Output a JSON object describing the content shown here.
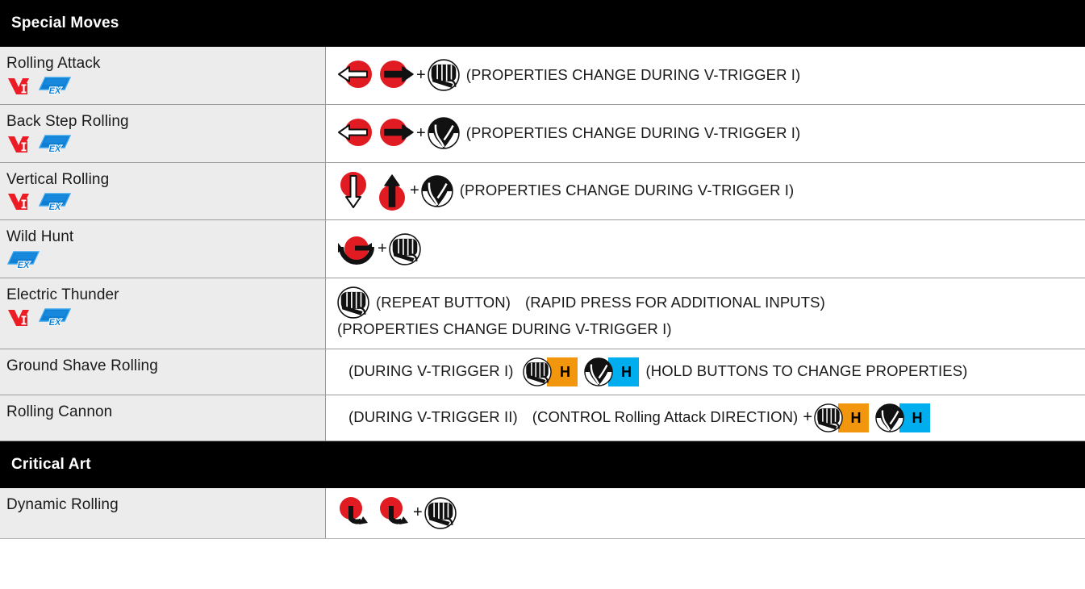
{
  "sections": [
    {
      "id": "special-moves",
      "title": "Special Moves",
      "moves": [
        {
          "name": "Rolling Attack",
          "badges": [
            "vtrigger-1",
            "ex"
          ],
          "inputs": [
            {
              "type": "dir-back"
            },
            {
              "type": "gap-sm"
            },
            {
              "type": "dir-forward"
            },
            {
              "type": "plus",
              "text": "+"
            },
            {
              "type": "punch"
            },
            {
              "type": "gap-sm"
            },
            {
              "type": "note",
              "text": "(PROPERTIES CHANGE DURING V-TRIGGER I)"
            }
          ]
        },
        {
          "name": "Back Step Rolling",
          "badges": [
            "vtrigger-1",
            "ex"
          ],
          "inputs": [
            {
              "type": "dir-back"
            },
            {
              "type": "gap-sm"
            },
            {
              "type": "dir-forward"
            },
            {
              "type": "plus",
              "text": "+"
            },
            {
              "type": "kick"
            },
            {
              "type": "gap-sm"
            },
            {
              "type": "note",
              "text": "(PROPERTIES CHANGE DURING V-TRIGGER I)"
            }
          ]
        },
        {
          "name": "Vertical Rolling",
          "badges": [
            "vtrigger-1",
            "ex"
          ],
          "inputs": [
            {
              "type": "dir-down"
            },
            {
              "type": "gap-sm"
            },
            {
              "type": "dir-up"
            },
            {
              "type": "plus",
              "text": "+"
            },
            {
              "type": "kick"
            },
            {
              "type": "gap-sm"
            },
            {
              "type": "note",
              "text": "(PROPERTIES CHANGE DURING V-TRIGGER I)"
            }
          ]
        },
        {
          "name": "Wild Hunt",
          "badges": [
            "ex"
          ],
          "inputs": [
            {
              "type": "half-circle-back"
            },
            {
              "type": "plus",
              "text": "+"
            },
            {
              "type": "punch"
            }
          ]
        },
        {
          "name": "Electric Thunder",
          "badges": [
            "vtrigger-1",
            "ex"
          ],
          "inputs": [
            {
              "type": "punch"
            },
            {
              "type": "gap-sm"
            },
            {
              "type": "note",
              "text": "(REPEAT BUTTON)"
            },
            {
              "type": "gap-md"
            },
            {
              "type": "note",
              "text": "(RAPID PRESS FOR ADDITIONAL INPUTS)"
            },
            {
              "type": "gap-md"
            },
            {
              "type": "note-wrap",
              "text": "(PROPERTIES CHANGE DURING V-TRIGGER I)"
            }
          ]
        },
        {
          "name": "Ground Shave Rolling",
          "badges": [],
          "inputs": [
            {
              "type": "gap-md"
            },
            {
              "type": "note",
              "text": "(DURING V-TRIGGER I)"
            },
            {
              "type": "gap-sm"
            },
            {
              "type": "hold-punch",
              "text": "H"
            },
            {
              "type": "gap-sm"
            },
            {
              "type": "hold-kick",
              "text": "H"
            },
            {
              "type": "gap-sm"
            },
            {
              "type": "note",
              "text": "(HOLD BUTTONS TO CHANGE PROPERTIES)"
            }
          ]
        },
        {
          "name": "Rolling Cannon",
          "badges": [],
          "inputs": [
            {
              "type": "gap-md"
            },
            {
              "type": "note",
              "text": "(DURING V-TRIGGER II)"
            },
            {
              "type": "gap-md"
            },
            {
              "type": "note",
              "text": "(CONTROL Rolling Attack DIRECTION)"
            },
            {
              "type": "plus",
              "text": "+"
            },
            {
              "type": "hold-punch",
              "text": "H"
            },
            {
              "type": "gap-sm"
            },
            {
              "type": "hold-kick",
              "text": "H"
            }
          ]
        }
      ]
    },
    {
      "id": "critical-art",
      "title": "Critical Art",
      "moves": [
        {
          "name": "Dynamic Rolling",
          "badges": [],
          "inputs": [
            {
              "type": "quarter-circle-forward"
            },
            {
              "type": "gap-sm"
            },
            {
              "type": "quarter-circle-forward"
            },
            {
              "type": "plus",
              "text": "+"
            },
            {
              "type": "punch"
            }
          ]
        }
      ]
    }
  ],
  "badge_labels": {
    "vtrigger-1": "V-Trigger I",
    "ex": "EX"
  },
  "colors": {
    "header_bg": "#000000",
    "header_text": "#ffffff",
    "name_cell_bg": "#ececec",
    "input_cell_bg": "#ffffff",
    "divider": "#9a9a9a",
    "direction_red": "#E01B22",
    "vtrigger_red": "#ED1C24",
    "ex_blue": "#0F7FD4",
    "hold_punch_orange": "#F2960D",
    "hold_kick_cyan": "#00AEEF",
    "text": "#1a1a1a"
  }
}
